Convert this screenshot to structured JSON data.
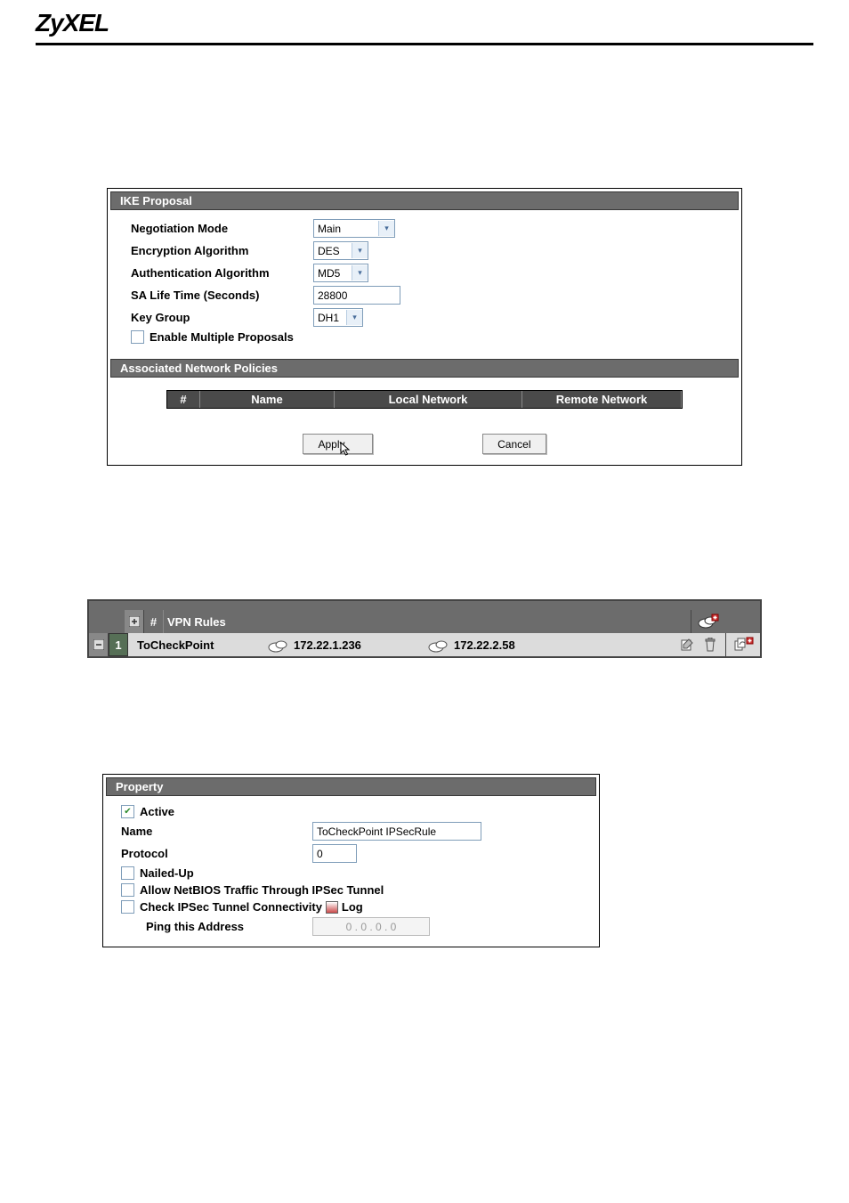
{
  "brand": "ZyXEL",
  "ike": {
    "title": "IKE Proposal",
    "neg_mode_label": "Negotiation Mode",
    "neg_mode_value": "Main",
    "enc_label": "Encryption Algorithm",
    "enc_value": "DES",
    "auth_label": "Authentication Algorithm",
    "auth_value": "MD5",
    "sa_label": "SA Life Time (Seconds)",
    "sa_value": "28800",
    "keygroup_label": "Key Group",
    "keygroup_value": "DH1",
    "enable_multiple_label": "Enable Multiple Proposals"
  },
  "assoc": {
    "title": "Associated Network Policies",
    "col_num": "#",
    "col_name": "Name",
    "col_local": "Local Network",
    "col_remote": "Remote Network"
  },
  "buttons": {
    "apply": "Apply",
    "cancel": "Cancel"
  },
  "vpn": {
    "header_title": "VPN Rules",
    "row_num": "1",
    "row_name": "ToCheckPoint",
    "row_local": "172.22.1.236",
    "row_remote": "172.22.2.58",
    "expand_header": "◧ #",
    "expand_data": "▣"
  },
  "prop": {
    "title": "Property",
    "active_label": "Active",
    "name_label": "Name",
    "name_value": "ToCheckPoint IPSecRule",
    "protocol_label": "Protocol",
    "protocol_value": "0",
    "nailed_label": "Nailed-Up",
    "netbios_label": "Allow NetBIOS Traffic Through IPSec Tunnel",
    "check_conn_label": "Check IPSec Tunnel Connectivity",
    "log_label": "Log",
    "ping_label": "Ping this Address",
    "ping_value": "0   .   0   .   0   .   0"
  }
}
